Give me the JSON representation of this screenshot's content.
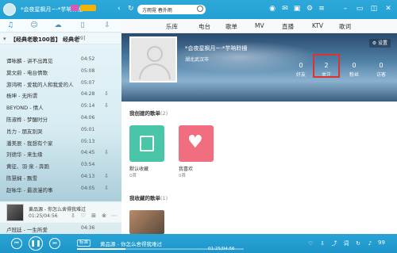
{
  "colors": {
    "accent": "#22a0d3",
    "highlight": "#e03030",
    "card_green": "#49c6a7",
    "card_pink": "#f06e80"
  },
  "topbar": {
    "username": "*会夜星枫月~-*芋呐聆栅",
    "search_text": "方雨霓 春外雨",
    "nav": [
      "乐库",
      "电台",
      "歌单",
      "MV",
      "直播",
      "KTV",
      "歌词"
    ]
  },
  "tabs": [
    "music-note-icon",
    "person-icon",
    "cloud-icon",
    "device-icon",
    "download-icon"
  ],
  "playlist": {
    "title": "【经典老歌100首】 经典老",
    "count": "[99]",
    "songs": [
      {
        "name": "谭咏麟 - 讲不出再见",
        "dur": "04:52"
      },
      {
        "name": "莫文蔚 - 电台情歌",
        "dur": "05:08"
      },
      {
        "name": "游鸿明 - 爱我的人和我爱的人",
        "dur": "05:07"
      },
      {
        "name": "杨坤 - 无所谓",
        "dur": "04:28"
      },
      {
        "name": "BEYOND - 情人",
        "dur": "05:14"
      },
      {
        "name": "陈淑桦 - 梦醒时分",
        "dur": "04:06"
      },
      {
        "name": "肖力 - 朋友别哭",
        "dur": "05:01"
      },
      {
        "name": "潘美辰 - 我想有个家",
        "dur": "05:13"
      },
      {
        "name": "刘德华 - 来生缘",
        "dur": "04:45"
      },
      {
        "name": "黄征、羽·泉 - 奔跑",
        "dur": "03:54"
      },
      {
        "name": "陈慧娴 - 飘雪",
        "dur": "04:13"
      },
      {
        "name": "赵咏华 - 最浪漫的事",
        "dur": "04:05"
      }
    ],
    "last_song": "卢冠廷 - 一生所爱",
    "last_dur": "04:36"
  },
  "now_playing": {
    "title": "黄品源 - 你怎么舍得我难过",
    "time": "01:25/04:56"
  },
  "main": {
    "settings": "设置",
    "profile_name": "*会夜星枫月~-*芋呐聆栅",
    "location": "湖北武汉市",
    "stats": [
      {
        "n": "0",
        "l": "好友"
      },
      {
        "n": "2",
        "l": "关注"
      },
      {
        "n": "0",
        "l": "粉丝"
      },
      {
        "n": "0",
        "l": "访客"
      }
    ],
    "created_title": "我创建的歌单",
    "created_count": "(2)",
    "cards": [
      {
        "label": "默认收藏",
        "count": "0首"
      },
      {
        "label": "我喜欢",
        "count": "0首"
      }
    ],
    "fav_title": "我收藏的歌单",
    "fav_count": "(1)"
  },
  "player": {
    "tag": "标准",
    "title": "黄品源 - 你怎么舍得我难过",
    "time": "01:25/04:56",
    "progress": 0.29,
    "volume": "99"
  }
}
